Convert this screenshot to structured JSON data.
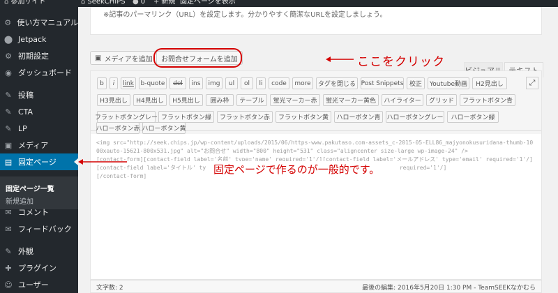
{
  "adminbar": {
    "site_name": "参加サイト",
    "site2": "SeekCHIPS",
    "comments_count": "0",
    "new_label": "新規",
    "view_page": "固定ページを表示"
  },
  "sidebar": {
    "items": [
      {
        "icon": "⚙",
        "label": "使い方マニュアル"
      },
      {
        "icon": "⬤",
        "label": "Jetpack"
      },
      {
        "icon": "⚙",
        "label": "初期設定"
      },
      {
        "icon": "◉",
        "label": "ダッシュボード"
      },
      {
        "icon": "✎",
        "label": "投稿"
      },
      {
        "icon": "✎",
        "label": "CTA"
      },
      {
        "icon": "✎",
        "label": "LP"
      },
      {
        "icon": "▣",
        "label": "メディア"
      },
      {
        "icon": "▤",
        "label": "固定ページ"
      },
      {
        "icon": "✉",
        "label": "コメント"
      },
      {
        "icon": "✉",
        "label": "フィードバック"
      },
      {
        "icon": "✎",
        "label": "外観"
      },
      {
        "icon": "✚",
        "label": "プラグイン"
      },
      {
        "icon": "☺",
        "label": "ユーザー"
      }
    ],
    "submenu": [
      "固定ページ一覧",
      "新規追加"
    ]
  },
  "editor": {
    "permalink_note": "※記事のパーマリンク（URL）を設定します。分かりやすく簡潔なURLを設定しましょう。",
    "add_media": "メディアを追加",
    "add_contact_form": "お問合せフォームを追加",
    "tab_visual": "ビジュアル",
    "tab_text": "テキスト",
    "quicktags": [
      "b",
      "i",
      "link",
      "b-quote",
      "del",
      "ins",
      "img",
      "ul",
      "ol",
      "li",
      "code",
      "more",
      "タグを閉じる",
      "Post Snippets",
      "校正",
      "Youtube動画",
      "H2見出し",
      "H3見出し",
      "H4見出し",
      "H5見出し",
      "囲み枠",
      "テーブル",
      "蛍光マーカー赤",
      "蛍光マーカー黄色",
      "ハイライター",
      "グリッド",
      "フラットボタン青",
      "フラットボタングレー",
      "フラットボタン緑",
      "フラットボタン赤",
      "フラットボタン黄",
      "ハローボタン青",
      "ハローボタングレー",
      "ハローボタン緑",
      "ハローボタン赤",
      "ハローボタン黄"
    ],
    "content": "<img src=\"http://seek.chips.jp/wp-content/uploads/2015/06/https-www.pakutaso.com-assets_c-2015-05-ELL86_majyonokusuridana-thumb-1000xauto-15621-800x531.jpg\" alt=\"お問合せ\" width=\"800\" height=\"531\" class=\"aligncenter size-large wp-image-24\" />\n[contact-form][contact-field label='名前' type='name' required='1'/][contact-field label='メールアドレス' type='email' required='1'/][contact-field label='タイトル' type='text'/][contact-field label='コメント' type='textarea' required='1'/]\n[/contact-form]",
    "word_count": "文字数: 2",
    "last_edit": "最後の編集: 2016年5月20日 1:30 PM - TeamSEEKなかむら"
  },
  "annotations": {
    "click_here": "ここをクリック",
    "fixed_page_note": "固定ページで作るのが一般的です。"
  },
  "colors": {
    "annotation_red": "#d40000",
    "admin_blue": "#0073aa",
    "sidebar_bg": "#23282d"
  }
}
